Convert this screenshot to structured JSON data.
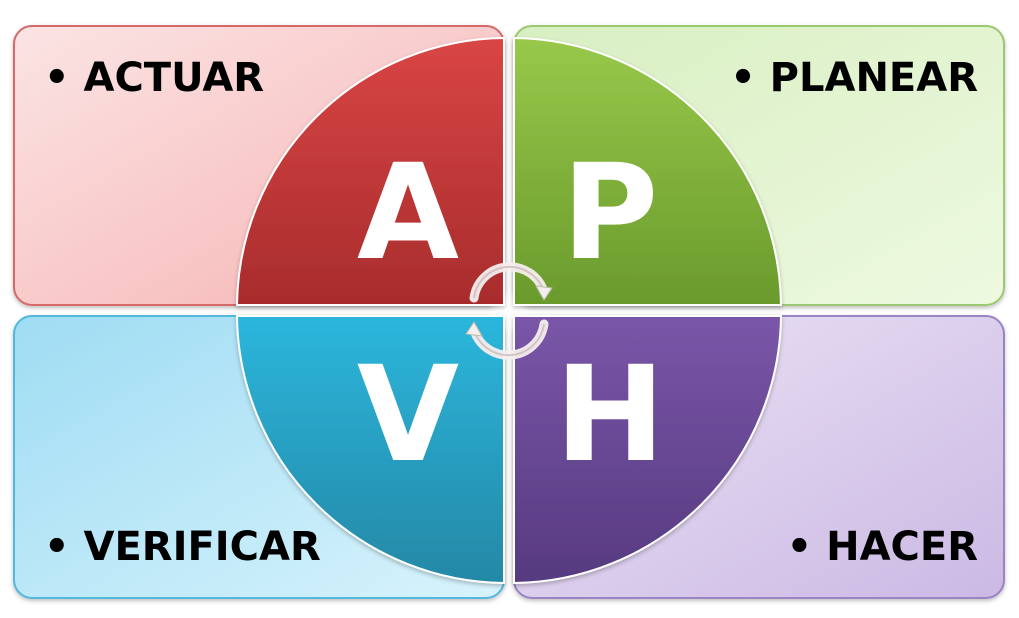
{
  "quadrants": {
    "actuar": {
      "label": "• ACTUAR",
      "letter": "A",
      "color": "#c93a3a"
    },
    "planear": {
      "label": "• PLANEAR",
      "letter": "P",
      "color": "#85b33b"
    },
    "verificar": {
      "label": "• VERIFICAR",
      "letter": "V",
      "color": "#2ea6c9"
    },
    "hacer": {
      "label": "• HACER",
      "letter": "H",
      "color": "#6e4a98"
    }
  },
  "center_icon": "cycle-arrows-icon"
}
